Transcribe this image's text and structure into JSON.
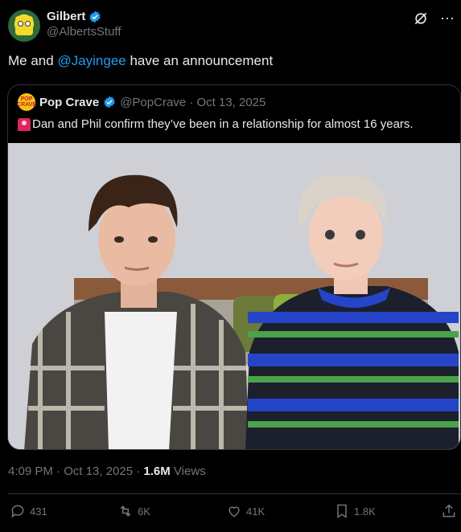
{
  "author": {
    "display_name": "Gilbert",
    "handle": "@AlbertsStuff"
  },
  "tweet": {
    "prefix": "Me and ",
    "mention": "@Jayingee",
    "suffix": " have an announcement"
  },
  "quote": {
    "avatar_text": "POP CRAVE",
    "display_name": "Pop Crave",
    "meta": "@PopCrave · Oct 13, 2025",
    "text": "Dan and Phil confirm they’ve been in a relationship for almost 16 years."
  },
  "timestamp": "4:09 PM · Oct 13, 2025 · ",
  "views_count": "1.6M",
  "views_label": " Views",
  "actions": {
    "replies": "431",
    "reposts": "6K",
    "likes": "41K",
    "bookmarks": "1.8K"
  },
  "colors": {
    "background": "#000000",
    "text": "#e7e9ea",
    "secondary": "#71767b",
    "link": "#1d9bf0",
    "border": "#2f3336"
  }
}
